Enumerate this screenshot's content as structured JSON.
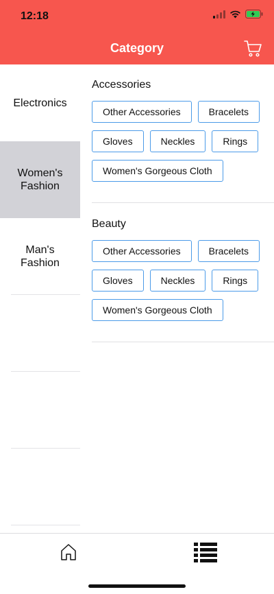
{
  "status_bar": {
    "time": "12:18"
  },
  "header": {
    "title": "Category"
  },
  "sidebar": {
    "items": [
      {
        "label": "Electronics"
      },
      {
        "label": "Women's Fashion"
      },
      {
        "label": "Man's Fashion"
      }
    ],
    "active_index": 1
  },
  "sections": [
    {
      "title": "Accessories",
      "tags": [
        "Other Accessories",
        "Bracelets",
        "Gloves",
        "Neckles",
        "Rings",
        "Women's Gorgeous Cloth"
      ]
    },
    {
      "title": "Beauty",
      "tags": [
        "Other Accessories",
        "Bracelets",
        "Gloves",
        "Neckles",
        "Rings",
        "Women's Gorgeous Cloth"
      ]
    }
  ],
  "tabbar": {
    "items": [
      "home-icon",
      "list-icon"
    ]
  },
  "colors": {
    "accent": "#f7564e",
    "tag_border": "#4a9ae8",
    "sidebar_active": "#d2d2d7"
  }
}
